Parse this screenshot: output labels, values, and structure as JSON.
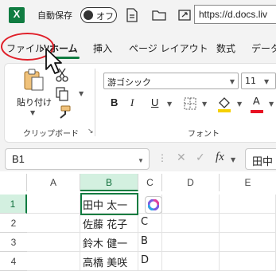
{
  "titlebar": {
    "app_logo_letter": "X",
    "autosave_label": "自動保存",
    "autosave_toggle": "オフ",
    "url": "https://d.docs.liv"
  },
  "tabs": [
    {
      "label": "ファイル",
      "active": false
    },
    {
      "label": "ホーム",
      "active": true
    },
    {
      "label": "挿入",
      "active": false
    },
    {
      "label": "ページ レイアウト",
      "active": false
    },
    {
      "label": "数式",
      "active": false
    },
    {
      "label": "データ",
      "active": false
    }
  ],
  "ribbon": {
    "clipboard": {
      "paste_label": "貼り付け",
      "group_label": "クリップボード"
    },
    "font": {
      "font_name": "游ゴシック",
      "font_size": "11",
      "bold": "B",
      "italic": "I",
      "underline": "U",
      "font_color_letter": "A",
      "group_label": "フォント"
    }
  },
  "formula_bar": {
    "name_box": "B1",
    "fx": "fx",
    "content": "田中"
  },
  "grid": {
    "columns": [
      "A",
      "B",
      "C",
      "D",
      "E"
    ],
    "selected_column": "B",
    "rows": [
      {
        "num": "1",
        "B": "田中 太一",
        "C": ""
      },
      {
        "num": "2",
        "B": "佐藤 花子",
        "C": "C"
      },
      {
        "num": "3",
        "B": "鈴木 健一",
        "C": "B"
      },
      {
        "num": "4",
        "B": "高橋 美咲",
        "C": "D"
      }
    ],
    "selected_row": "1"
  },
  "colors": {
    "excel_green": "#107c41",
    "highlight_red": "#e0202a",
    "fill_yellow": "#f5d000",
    "font_red": "#e81123"
  }
}
